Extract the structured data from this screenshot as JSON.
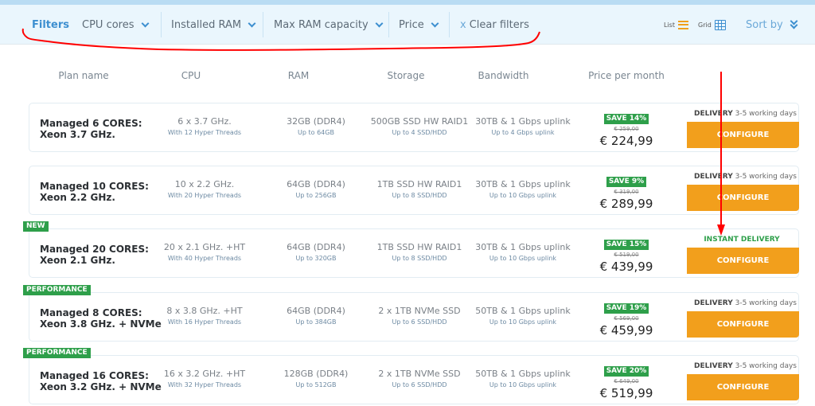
{
  "filterbar": {
    "filters_label": "Filters",
    "dropdowns": [
      {
        "label": "CPU cores"
      },
      {
        "label": "Installed RAM"
      },
      {
        "label": "Max RAM capacity"
      },
      {
        "label": "Price"
      }
    ],
    "clear_x": "x",
    "clear_label": "Clear filters",
    "list_label": "List",
    "grid_label": "Grid",
    "sort_label": "Sort by",
    "icons": {
      "list": "list-icon",
      "grid": "grid-icon",
      "sort": "double-chevron-down-icon",
      "dropdown": "chevron-down-icon"
    }
  },
  "columns": [
    "Plan name",
    "CPU",
    "RAM",
    "Storage",
    "Bandwidth",
    "Price per month"
  ],
  "plans": [
    {
      "ribbon": "",
      "name_line1": "Managed 6 CORES:",
      "name_line2": "Xeon 3.7 GHz.",
      "cpu": "6 x 3.7 GHz.",
      "cpu_sub": "With 12 Hyper Threads",
      "ram": "32GB (DDR4)",
      "ram_sub": "Up to 64GB",
      "storage": "500GB SSD HW RAID1",
      "storage_sub": "Up to 4 SSD/HDD",
      "bandwidth": "30TB & 1 Gbps uplink",
      "bandwidth_sub": "Up to 4 Gbps uplink",
      "save": "SAVE 14%",
      "old_price": "€ 259,00",
      "price": "€ 224,99",
      "delivery_label": "DELIVERY",
      "delivery_time": "3-5 working days",
      "configure": "CONFIGURE"
    },
    {
      "ribbon": "",
      "name_line1": "Managed 10 CORES:",
      "name_line2": "Xeon 2.2 GHz.",
      "cpu": "10 x 2.2 GHz.",
      "cpu_sub": "With 20 Hyper Threads",
      "ram": "64GB (DDR4)",
      "ram_sub": "Up to 256GB",
      "storage": "1TB SSD HW RAID1",
      "storage_sub": "Up to 8 SSD/HDD",
      "bandwidth": "30TB & 1 Gbps uplink",
      "bandwidth_sub": "Up to 10 Gbps uplink",
      "save": "SAVE 9%",
      "old_price": "€ 319,00",
      "price": "€ 289,99",
      "delivery_label": "DELIVERY",
      "delivery_time": "3-5 working days",
      "configure": "CONFIGURE"
    },
    {
      "ribbon": "NEW",
      "name_line1": "Managed 20 CORES:",
      "name_line2": "Xeon 2.1 GHz.",
      "cpu": "20 x 2.1 GHz. +HT",
      "cpu_sub": "With 40 Hyper Threads",
      "ram": "64GB (DDR4)",
      "ram_sub": "Up to 320GB",
      "storage": "1TB SSD HW RAID1",
      "storage_sub": "Up to 8 SSD/HDD",
      "bandwidth": "30TB & 1 Gbps uplink",
      "bandwidth_sub": "Up to 10 Gbps uplink",
      "save": "SAVE 15%",
      "old_price": "€ 519,00",
      "price": "€ 439,99",
      "delivery_instant": "INSTANT DELIVERY",
      "configure": "CONFIGURE"
    },
    {
      "ribbon": "PERFORMANCE",
      "name_line1": "Managed 8 CORES:",
      "name_line2": "Xeon 3.8 GHz. + NVMe",
      "cpu": "8 x 3.8 GHz. +HT",
      "cpu_sub": "With 16 Hyper Threads",
      "ram": "64GB (DDR4)",
      "ram_sub": "Up to 384GB",
      "storage": "2 x 1TB NVMe SSD",
      "storage_sub": "Up to 6 SSD/HDD",
      "bandwidth": "50TB & 1 Gbps uplink",
      "bandwidth_sub": "Up to 10 Gbps uplink",
      "save": "SAVE 19%",
      "old_price": "€ 569,00",
      "price": "€ 459,99",
      "delivery_label": "DELIVERY",
      "delivery_time": "3-5 working days",
      "configure": "CONFIGURE"
    },
    {
      "ribbon": "PERFORMANCE",
      "name_line1": "Managed 16 CORES:",
      "name_line2": "Xeon 3.2 GHz. + NVMe",
      "cpu": "16 x 3.2 GHz. +HT",
      "cpu_sub": "With 32 Hyper Threads",
      "ram": "128GB (DDR4)",
      "ram_sub": "Up to 512GB",
      "storage": "2 x 1TB NVMe SSD",
      "storage_sub": "Up to 6 SSD/HDD",
      "bandwidth": "50TB & 1 Gbps uplink",
      "bandwidth_sub": "Up to 10 Gbps uplink",
      "save": "SAVE 20%",
      "old_price": "€ 649,00",
      "price": "€ 519,99",
      "delivery_label": "DELIVERY",
      "delivery_time": "3-5 working days",
      "configure": "CONFIGURE"
    }
  ],
  "colors": {
    "accent_blue": "#3d8fd0",
    "configure_orange": "#f29f1c",
    "badge_green": "#2e9f4a",
    "annotation_red": "#ff0000"
  }
}
